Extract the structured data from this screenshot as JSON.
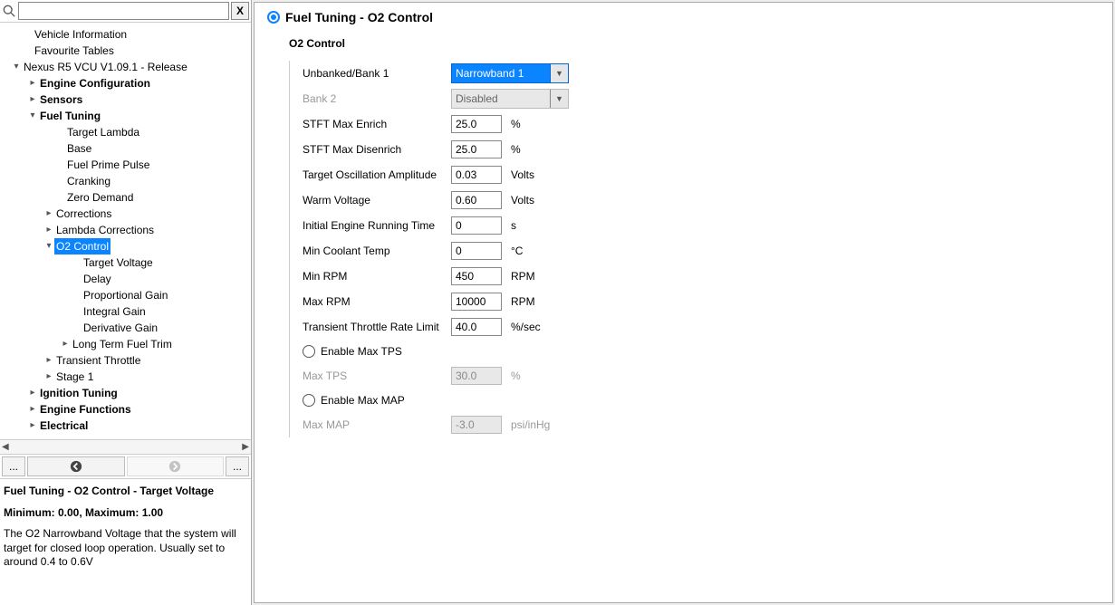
{
  "search": {
    "clear_label": "X"
  },
  "tree": {
    "items": [
      {
        "pad": 20,
        "arrow": "",
        "label": "Vehicle Information",
        "bold": false
      },
      {
        "pad": 20,
        "arrow": "",
        "label": "Favourite Tables",
        "bold": false
      },
      {
        "pad": 8,
        "arrow": "▾",
        "label": "Nexus R5 VCU V1.09.1 - Release",
        "bold": false
      },
      {
        "pad": 26,
        "arrow": "▸",
        "label": "Engine Configuration",
        "bold": true
      },
      {
        "pad": 26,
        "arrow": "▸",
        "label": "Sensors",
        "bold": true
      },
      {
        "pad": 26,
        "arrow": "▾",
        "label": "Fuel Tuning",
        "bold": true
      },
      {
        "pad": 56,
        "arrow": "",
        "label": "Target Lambda",
        "bold": false
      },
      {
        "pad": 56,
        "arrow": "",
        "label": "Base",
        "bold": false
      },
      {
        "pad": 56,
        "arrow": "",
        "label": "Fuel Prime Pulse",
        "bold": false
      },
      {
        "pad": 56,
        "arrow": "",
        "label": "Cranking",
        "bold": false
      },
      {
        "pad": 56,
        "arrow": "",
        "label": "Zero Demand",
        "bold": false
      },
      {
        "pad": 44,
        "arrow": "▸",
        "label": "Corrections",
        "bold": false
      },
      {
        "pad": 44,
        "arrow": "▸",
        "label": "Lambda Corrections",
        "bold": false
      },
      {
        "pad": 44,
        "arrow": "▾",
        "label": "O2 Control",
        "bold": false,
        "selected": true
      },
      {
        "pad": 74,
        "arrow": "",
        "label": "Target Voltage",
        "bold": false
      },
      {
        "pad": 74,
        "arrow": "",
        "label": "Delay",
        "bold": false
      },
      {
        "pad": 74,
        "arrow": "",
        "label": "Proportional Gain",
        "bold": false
      },
      {
        "pad": 74,
        "arrow": "",
        "label": "Integral Gain",
        "bold": false
      },
      {
        "pad": 74,
        "arrow": "",
        "label": "Derivative Gain",
        "bold": false
      },
      {
        "pad": 62,
        "arrow": "▸",
        "label": "Long Term Fuel Trim",
        "bold": false
      },
      {
        "pad": 44,
        "arrow": "▸",
        "label": "Transient Throttle",
        "bold": false
      },
      {
        "pad": 44,
        "arrow": "▸",
        "label": "Stage 1",
        "bold": false
      },
      {
        "pad": 26,
        "arrow": "▸",
        "label": "Ignition Tuning",
        "bold": true
      },
      {
        "pad": 26,
        "arrow": "▸",
        "label": "Engine Functions",
        "bold": true
      },
      {
        "pad": 26,
        "arrow": "▸",
        "label": "Electrical",
        "bold": true
      }
    ]
  },
  "help_nav": {
    "left_small": "...",
    "right_small": "..."
  },
  "help": {
    "title": "Fuel Tuning - O2 Control - Target Voltage",
    "range": "Minimum: 0.00, Maximum: 1.00",
    "desc": "The O2 Narrowband Voltage that the system will target for closed loop operation. Usually set to around 0.4 to 0.6V"
  },
  "page": {
    "title": "Fuel Tuning - O2 Control",
    "section": "O2 Control"
  },
  "form": {
    "bank1": {
      "label": "Unbanked/Bank 1",
      "value": "Narrowband 1"
    },
    "bank2": {
      "label": "Bank 2",
      "value": "Disabled"
    },
    "stft_enrich": {
      "label": "STFT Max Enrich",
      "value": "25.0",
      "unit": "%"
    },
    "stft_disenrich": {
      "label": "STFT Max Disenrich",
      "value": "25.0",
      "unit": "%"
    },
    "osc_amp": {
      "label": "Target Oscillation Amplitude",
      "value": "0.03",
      "unit": "Volts"
    },
    "warm_v": {
      "label": "Warm Voltage",
      "value": "0.60",
      "unit": "Volts"
    },
    "init_run": {
      "label": "Initial Engine Running Time",
      "value": "0",
      "unit": "s"
    },
    "min_coolant": {
      "label": "Min Coolant Temp",
      "value": "0",
      "unit": "°C"
    },
    "min_rpm": {
      "label": "Min RPM",
      "value": "450",
      "unit": "RPM"
    },
    "max_rpm": {
      "label": "Max RPM",
      "value": "10000",
      "unit": "RPM"
    },
    "trans_throttle": {
      "label": "Transient Throttle Rate Limit",
      "value": "40.0",
      "unit": "%/sec"
    },
    "enable_max_tps": {
      "label": "Enable Max TPS"
    },
    "max_tps": {
      "label": "Max TPS",
      "value": "30.0",
      "unit": "%"
    },
    "enable_max_map": {
      "label": "Enable Max MAP"
    },
    "max_map": {
      "label": "Max MAP",
      "value": "-3.0",
      "unit": "psi/inHg"
    }
  }
}
